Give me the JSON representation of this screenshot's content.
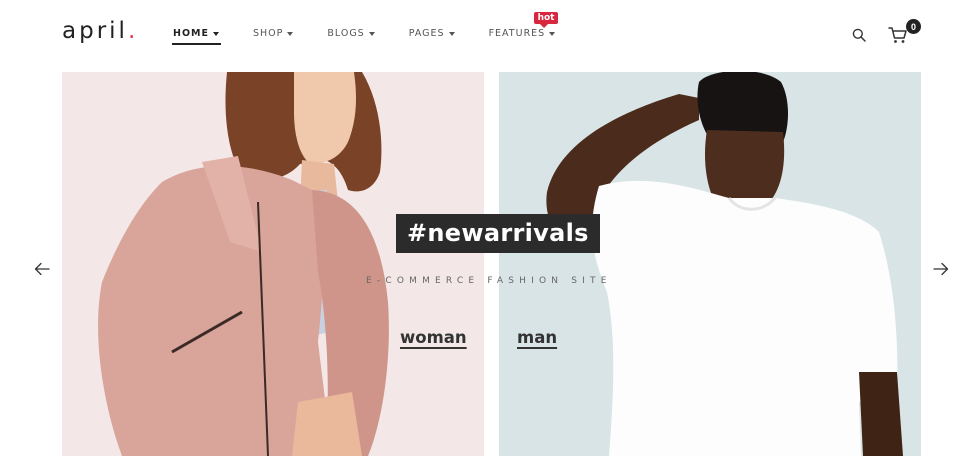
{
  "brand": {
    "name": "april",
    "dot": ".",
    "accent": "#e5364a"
  },
  "nav": {
    "items": [
      {
        "label": "HOME",
        "active": true
      },
      {
        "label": "SHOP",
        "active": false
      },
      {
        "label": "BLOGS",
        "active": false
      },
      {
        "label": "PAGES",
        "active": false
      },
      {
        "label": "FEATURES",
        "active": false,
        "badge": "hot"
      }
    ]
  },
  "header": {
    "search_icon": "search-icon",
    "cart_icon": "cart-icon",
    "cart_count": "0"
  },
  "hero": {
    "headline": "#newarrivals",
    "tagline": "E-COMMERCE FASHION SITE",
    "links": {
      "woman": "woman",
      "man": "man"
    },
    "prev_icon": "arrow-left-icon",
    "next_icon": "arrow-right-icon",
    "left_bg": "#f3e8e7",
    "right_bg": "#d9e4e6"
  }
}
